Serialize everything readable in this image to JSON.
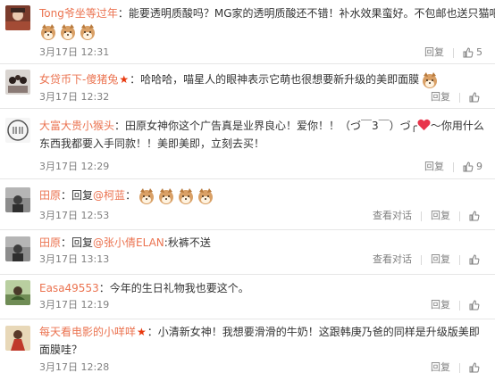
{
  "comments": [
    {
      "username": "Tong爷坐等过年",
      "separator": "：",
      "text": "能要透明质酸吗？MG家的透明质酸还不错！补水效果蛮好。不包邮也送只猫吧！",
      "time": "3月17日 12:31",
      "reply_label": "回复",
      "like_count": "5",
      "stickers": [
        "shiba-sticker",
        "shiba-sticker",
        "shiba-sticker"
      ]
    },
    {
      "username": "女贷币下-傻猪兔",
      "separator": "：",
      "text": "哈哈哈，喵星人的眼神表示它萌也很想要新升级的美即面膜",
      "time": "3月17日 12:32",
      "reply_label": "回复",
      "like_count": "",
      "stickers": [
        "shiba-sticker"
      ]
    },
    {
      "username": "大富大贵小猴头",
      "separator": "：",
      "text": "田原女神你这个广告真是业界良心！爱你！！（づ￣3￣）づ╭",
      "text_after_heart": "～你用什么东西我都要入手同款！！美即美即，立刻去买！",
      "time": "3月17日 12:29",
      "reply_label": "回复",
      "like_count": "9"
    },
    {
      "username": "田原",
      "separator": "：",
      "reply_prefix": "回复",
      "mention": "@柯蓝",
      "mention_sep": "：",
      "time": "3月17日 12:53",
      "view_convo_label": "查看对话",
      "reply_label": "回复",
      "like_count": "",
      "stickers": [
        "shiba-sticker",
        "shiba-sticker",
        "shiba-sticker",
        "shiba-sticker"
      ]
    },
    {
      "username": "田原",
      "separator": "：",
      "reply_prefix": "回复",
      "mention": "@张小倩ELAN",
      "mention_sep": ":",
      "text": "秋裤不送",
      "time": "3月17日 13:13",
      "view_convo_label": "查看对话",
      "reply_label": "回复",
      "like_count": ""
    },
    {
      "username": "Easa49553",
      "separator": "：",
      "text": "今年的生日礼物我也要这个。",
      "time": "3月17日 12:19",
      "reply_label": "回复",
      "like_count": ""
    },
    {
      "username": "每天看电影的小咩咩",
      "separator": "：",
      "text": "小清新女神！我想要滑滑的牛奶！这跟韩庚乃爸的同样是升级版美即面膜哇？",
      "time": "3月17日 12:28",
      "reply_label": "回复",
      "like_count": ""
    }
  ],
  "colors": {
    "username": "#eb7350",
    "text": "#333333",
    "meta": "#808080",
    "divider": "#e6e6e6",
    "star": "#e8380d",
    "heart": "#e8334a"
  }
}
